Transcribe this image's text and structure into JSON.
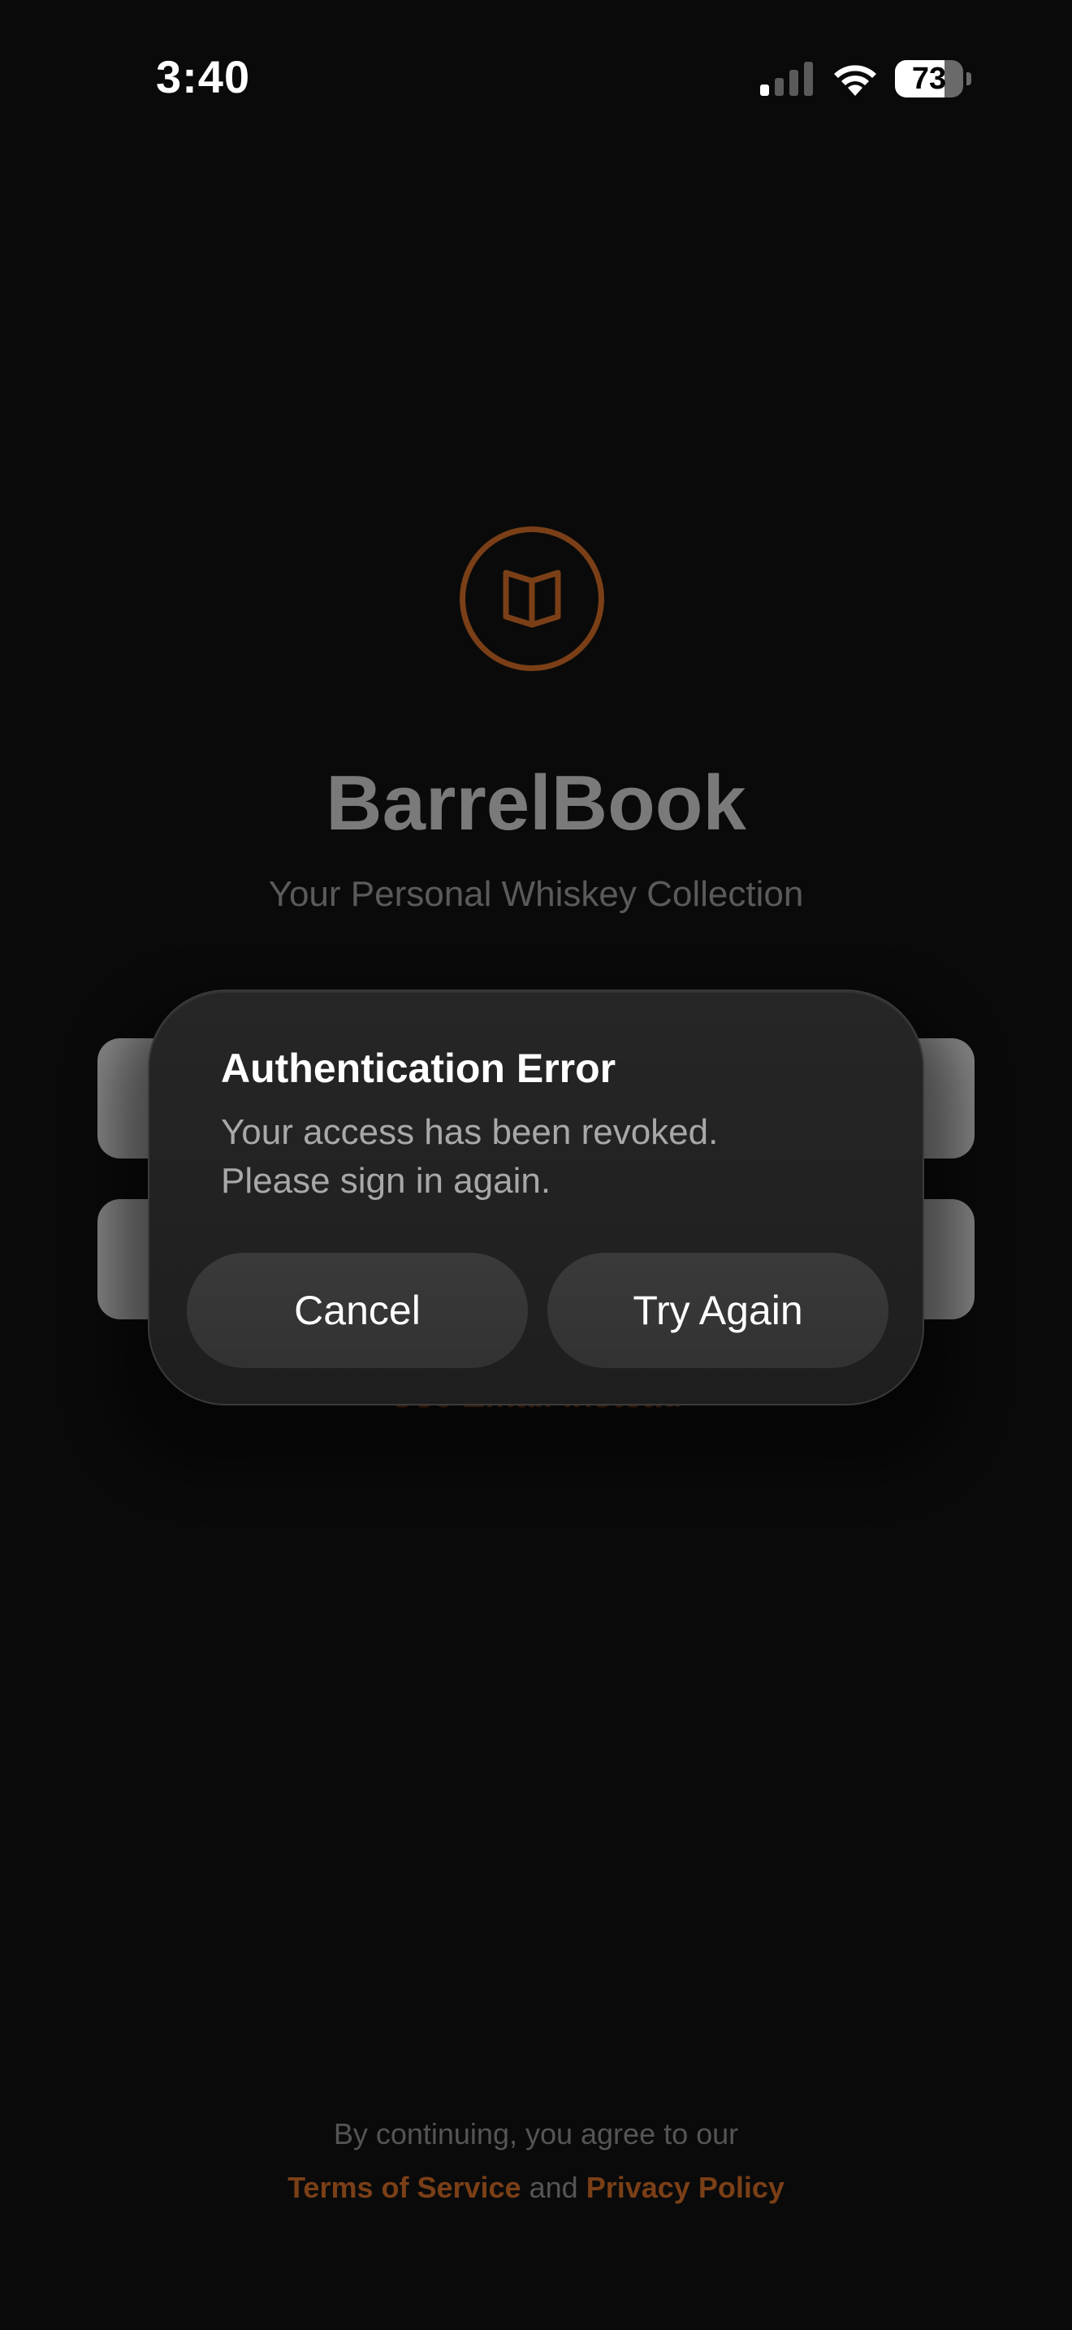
{
  "status_bar": {
    "time": "3:40",
    "battery_level": "73",
    "battery_fraction": 0.73
  },
  "app": {
    "logo_icon": "book-icon",
    "title": "BarrelBook",
    "subtitle": "Your Personal Whiskey Collection",
    "email_link": "Use Email Instead",
    "accent_color": "#7b3f17"
  },
  "alert": {
    "title": "Authentication Error",
    "message_line1": "Your access has been revoked.",
    "message_line2": "Please sign in again.",
    "cancel_label": "Cancel",
    "retry_label": "Try Again"
  },
  "footer": {
    "prefix": "By continuing, you agree to our",
    "terms": "Terms of Service",
    "and": "and",
    "privacy": "Privacy Policy"
  }
}
